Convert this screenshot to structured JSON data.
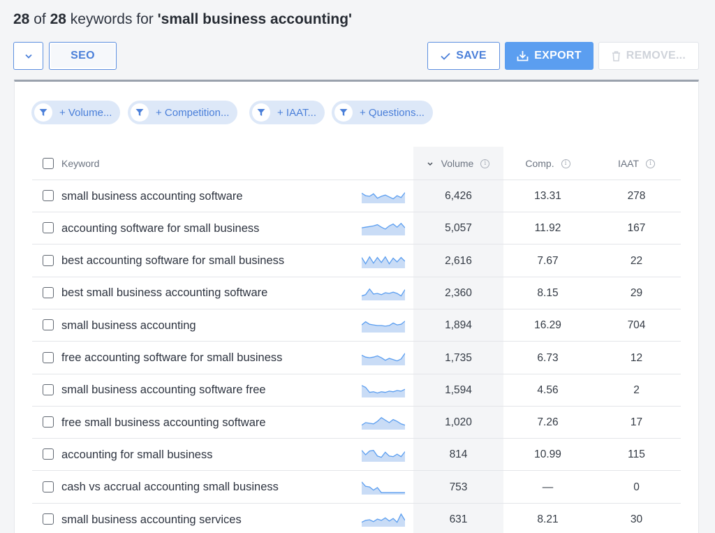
{
  "header": {
    "count": "28",
    "of_label": "of",
    "total": "28",
    "keywords_for_label": "keywords for",
    "query": "'small business accounting'"
  },
  "toolbar": {
    "dropdown_icon": "chevron-down-icon",
    "seo_label": "SEO",
    "save_label": "SAVE",
    "export_label": "EXPORT",
    "remove_label": "REMOVE..."
  },
  "filters": [
    {
      "label": "+ Volume..."
    },
    {
      "label": "+ Competition..."
    },
    {
      "label": "+ IAAT..."
    },
    {
      "label": "+ Questions..."
    }
  ],
  "columns": {
    "keyword": "Keyword",
    "volume": "Volume",
    "comp": "Comp.",
    "iaat": "IAAT",
    "sorted_column": "volume",
    "sort_direction": "descending"
  },
  "rows": [
    {
      "keyword": "small business accounting software",
      "volume": "6,426",
      "comp": "13.31",
      "iaat": "278",
      "trend": [
        0.75,
        0.55,
        0.5,
        0.7,
        0.35,
        0.5,
        0.6,
        0.45,
        0.3,
        0.55,
        0.4,
        0.8
      ]
    },
    {
      "keyword": "accounting software for small business",
      "volume": "5,057",
      "comp": "11.92",
      "iaat": "167",
      "trend": [
        0.55,
        0.6,
        0.65,
        0.7,
        0.8,
        0.6,
        0.45,
        0.7,
        0.85,
        0.6,
        0.9,
        0.55
      ]
    },
    {
      "keyword": "best accounting software for small business",
      "volume": "2,616",
      "comp": "7.67",
      "iaat": "22",
      "trend": [
        0.8,
        0.3,
        0.85,
        0.35,
        0.8,
        0.4,
        0.85,
        0.3,
        0.75,
        0.45,
        0.8,
        0.5
      ]
    },
    {
      "keyword": "best small business accounting software",
      "volume": "2,360",
      "comp": "8.15",
      "iaat": "29",
      "trend": [
        0.3,
        0.4,
        0.85,
        0.45,
        0.5,
        0.4,
        0.55,
        0.5,
        0.6,
        0.5,
        0.3,
        0.8
      ]
    },
    {
      "keyword": "small business accounting",
      "volume": "1,894",
      "comp": "16.29",
      "iaat": "704",
      "trend": [
        0.55,
        0.8,
        0.6,
        0.55,
        0.5,
        0.5,
        0.45,
        0.5,
        0.7,
        0.55,
        0.6,
        0.85
      ]
    },
    {
      "keyword": "free accounting software for small business",
      "volume": "1,735",
      "comp": "6.73",
      "iaat": "12",
      "trend": [
        0.75,
        0.6,
        0.55,
        0.6,
        0.7,
        0.55,
        0.35,
        0.5,
        0.4,
        0.3,
        0.45,
        0.9
      ]
    },
    {
      "keyword": "small business accounting software free",
      "volume": "1,594",
      "comp": "4.56",
      "iaat": "2",
      "trend": [
        0.9,
        0.75,
        0.35,
        0.4,
        0.3,
        0.4,
        0.35,
        0.45,
        0.4,
        0.5,
        0.45,
        0.6
      ]
    },
    {
      "keyword": "free small business accounting software",
      "volume": "1,020",
      "comp": "7.26",
      "iaat": "17",
      "trend": [
        0.3,
        0.5,
        0.45,
        0.4,
        0.6,
        0.9,
        0.7,
        0.5,
        0.75,
        0.6,
        0.4,
        0.3
      ]
    },
    {
      "keyword": "accounting for small business",
      "volume": "814",
      "comp": "10.99",
      "iaat": "115",
      "trend": [
        0.85,
        0.5,
        0.8,
        0.85,
        0.4,
        0.3,
        0.7,
        0.4,
        0.35,
        0.55,
        0.35,
        0.75
      ]
    },
    {
      "keyword": "cash vs accrual accounting small business",
      "volume": "753",
      "comp": "—",
      "iaat": "0",
      "trend": [
        0.95,
        0.6,
        0.55,
        0.3,
        0.5,
        0.1,
        0.1,
        0.1,
        0.1,
        0.1,
        0.1,
        0.1
      ]
    },
    {
      "keyword": "small business accounting services",
      "volume": "631",
      "comp": "8.21",
      "iaat": "30",
      "trend": [
        0.3,
        0.45,
        0.5,
        0.35,
        0.55,
        0.45,
        0.65,
        0.4,
        0.6,
        0.3,
        0.95,
        0.45
      ]
    }
  ],
  "colors": {
    "accent": "#4a7fd9",
    "export_bg": "#5b9ef0",
    "chip_bg": "#dde8f8",
    "spark_stroke": "#5b9ef0",
    "spark_fill": "#c9dcf6"
  }
}
